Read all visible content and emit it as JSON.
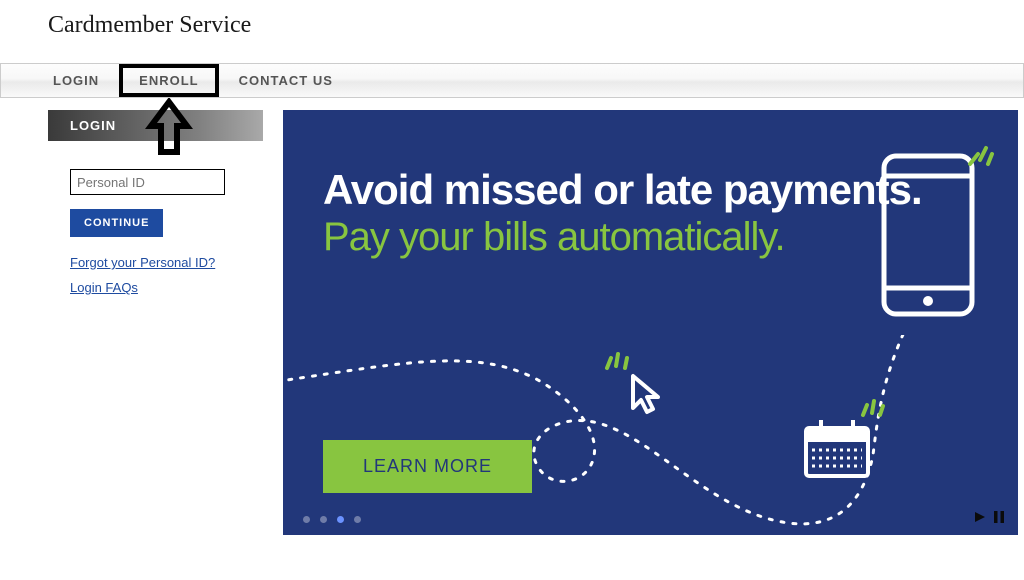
{
  "brand": "Cardmember Service",
  "nav": {
    "items": [
      {
        "label": "LOGIN"
      },
      {
        "label": "ENROLL"
      },
      {
        "label": "CONTACT US"
      }
    ]
  },
  "login": {
    "title": "LOGIN",
    "personal_id_placeholder": "Personal ID",
    "continue_label": "CONTINUE",
    "forgot_link": "Forgot your Personal ID?",
    "faqs_link": "Login FAQs"
  },
  "hero": {
    "headline_bold": "Avoid missed or late payments.",
    "headline_sub": "Pay your bills automatically.",
    "cta": "LEARN MORE",
    "dot_count": 4,
    "active_dot": 2
  },
  "colors": {
    "hero_bg": "#22377a",
    "accent_green": "#88c540",
    "primary_blue": "#1e4ba0"
  }
}
